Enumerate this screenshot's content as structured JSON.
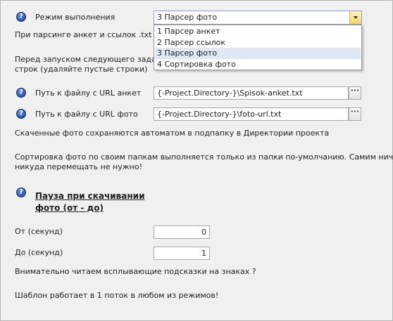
{
  "mode": {
    "label": "Режим выполнения",
    "selected": "3 Парсер фото",
    "options": [
      "1 Парсер анкет",
      "2 Парсер ссылок",
      "3 Парсер фото",
      "4 Сортировка фото"
    ]
  },
  "notes": {
    "parsing_partial": "При парсинге анкет и ссылок .txt файл",
    "before_start_line1": "Перед запуском следующего задания (",
    "before_start_line2": "строк (удаляйте пустые строки)"
  },
  "url_anket": {
    "label": "Путь к файлу с URL анкет",
    "value": "{-Project.Directory-}\\Spisok-anket.txt",
    "browse": "···"
  },
  "url_foto": {
    "label": "Путь к файлу с URL фото",
    "value": "{-Project.Directory-}\\foto-url.txt",
    "browse": "···"
  },
  "info": {
    "saved_photos": "Скаченные фото сохраняются автоматом в подпапку в Директории проекта",
    "sorting_line1": "Сортировка фото по своим папкам выполняется только из папки по-умолчанию. Самим ничего",
    "sorting_line2": "никуда перемещать не нужно!"
  },
  "pause": {
    "heading_line1": "Пауза при скачивании",
    "heading_line2": "фото (от - до)"
  },
  "from": {
    "label": "От (секунд)",
    "value": "0"
  },
  "to": {
    "label": "До (секунд)",
    "value": "1"
  },
  "footer": {
    "read_hints": "Внимательно читаем всплывающие подсказки на знаках ?",
    "threads": "Шаблон работает в 1 поток в любом из режимов!"
  }
}
